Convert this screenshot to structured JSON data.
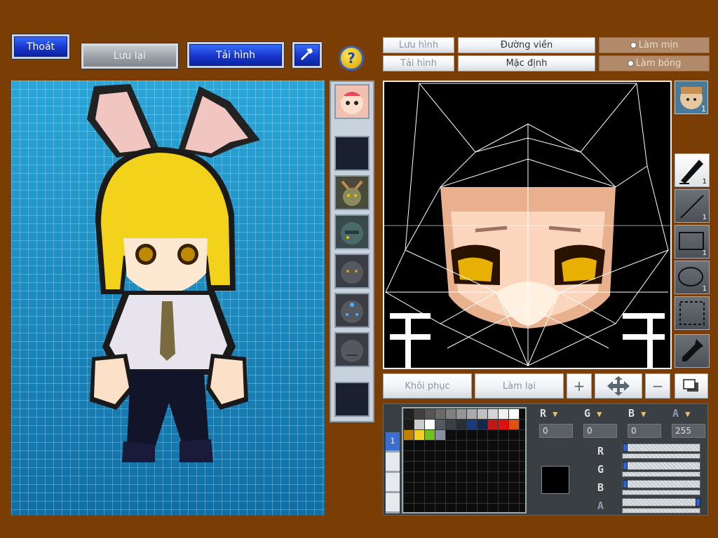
{
  "top": {
    "exit_label": "Thoát",
    "save_label": "Lưu lại",
    "load_label": "Tải hình",
    "help_label": "?"
  },
  "editor": {
    "save_image_label": "Lưu hình",
    "load_image_label": "Tải hình",
    "outline_label": "Đường viền",
    "default_label": "Mặc định",
    "smooth_label": "Làm mịn",
    "shade_label": "Làm bóng",
    "restore_label": "Khôi phục",
    "redo_label": "Làm lại"
  },
  "tools": [
    {
      "name": "pen-tool",
      "count": "1"
    },
    {
      "name": "line-tool",
      "count": "1"
    },
    {
      "name": "rect-tool",
      "count": "1"
    },
    {
      "name": "ellipse-tool",
      "count": "1"
    },
    {
      "name": "select-tool",
      "count": ""
    },
    {
      "name": "eyedropper-tool",
      "count": ""
    }
  ],
  "avatar_badge": "1",
  "color": {
    "r_label": "R",
    "g_label": "G",
    "b_label": "B",
    "a_label": "A",
    "r_value": "0",
    "g_value": "0",
    "b_value": "0",
    "a_value": "255",
    "current": "#000000",
    "palette_tab": "1",
    "palette_colors": [
      "#202020",
      "#404040",
      "#555555",
      "#6a6a6a",
      "#808080",
      "#959595",
      "#aaaaaa",
      "#c0c0c0",
      "#d5d5d5",
      "#f0f0f0",
      "#ffffff",
      "#1a1a1a",
      "#cccccc",
      "#ffffff",
      "#555a60",
      "#3a3f44",
      "#2a2f34",
      "#1a3a7a",
      "#14284a",
      "#c01818",
      "#e01010",
      "#e05010",
      "#c08000",
      "#f0d020",
      "#70c020",
      "#8a8fa0"
    ]
  }
}
